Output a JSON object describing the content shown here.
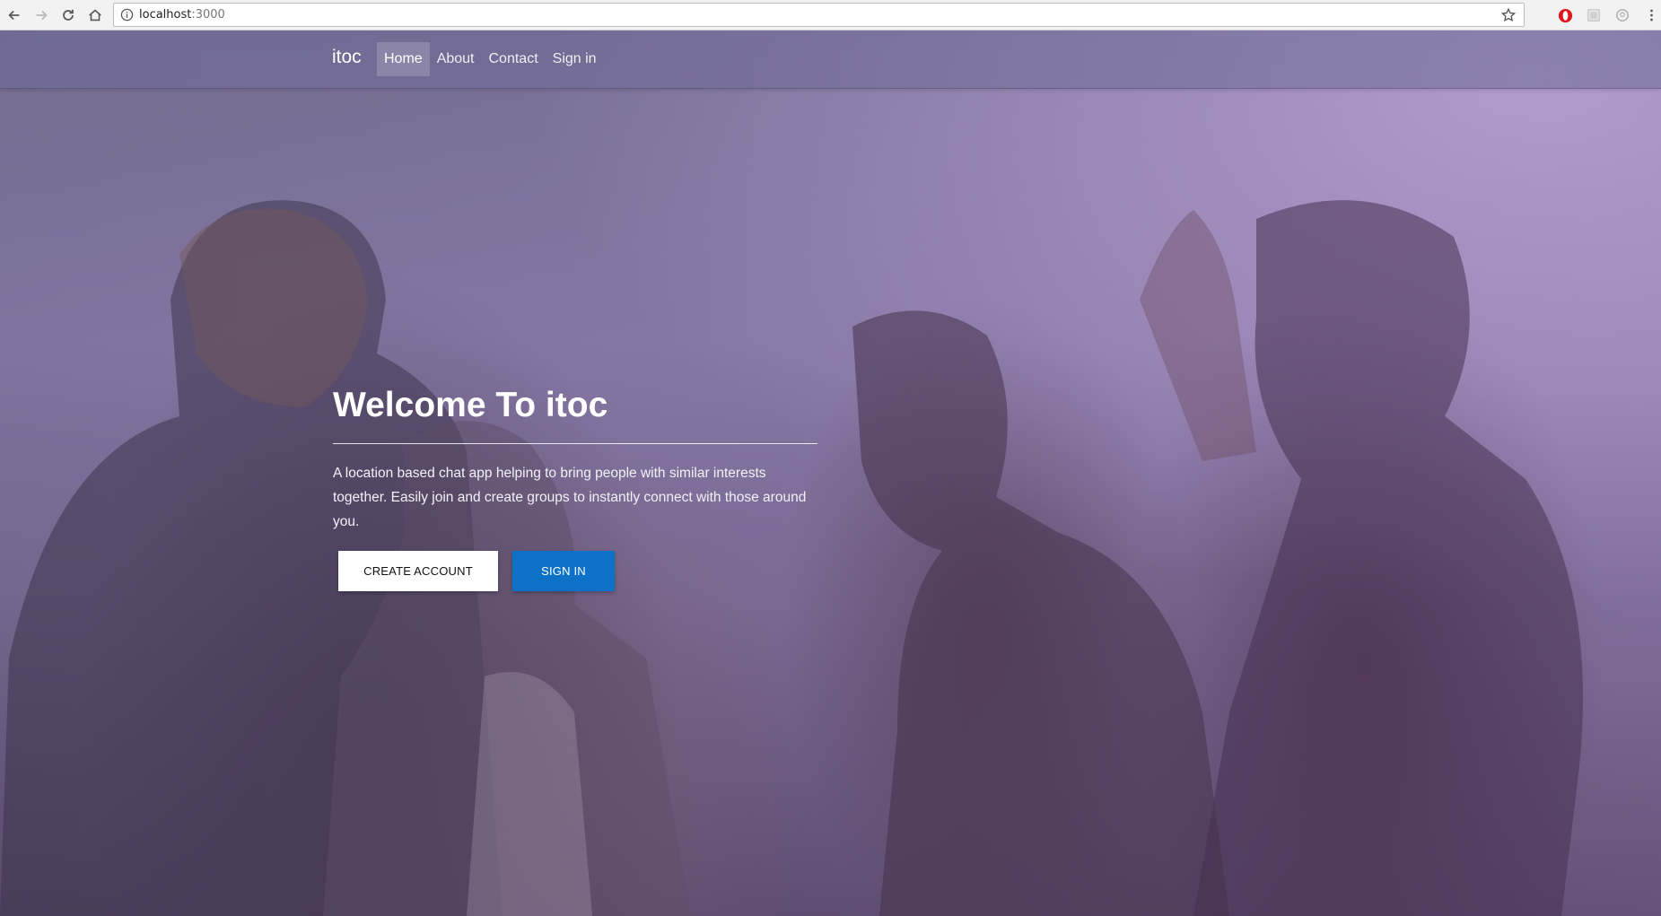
{
  "browser": {
    "url_host": "localhost",
    "url_port": ":3000",
    "icons": [
      "back-icon",
      "forward-icon",
      "reload-icon",
      "home-icon",
      "info-icon",
      "star-icon",
      "opera-extension-icon",
      "extension-icon",
      "account-icon",
      "menu-icon"
    ]
  },
  "navbar": {
    "brand": "itoc",
    "links": [
      {
        "label": "Home",
        "active": true
      },
      {
        "label": "About"
      },
      {
        "label": "Contact"
      },
      {
        "label": "Sign in"
      }
    ]
  },
  "hero": {
    "title": "Welcome To itoc",
    "description": "A location based chat app helping to bring people with similar interests together. Easily join and create groups to instantly connect with those around you.",
    "create_account_label": "CREATE ACCOUNT",
    "sign_in_label": "SIGN IN"
  },
  "colors": {
    "accent": "#0d71c8",
    "overlay": "#8a7da6"
  }
}
